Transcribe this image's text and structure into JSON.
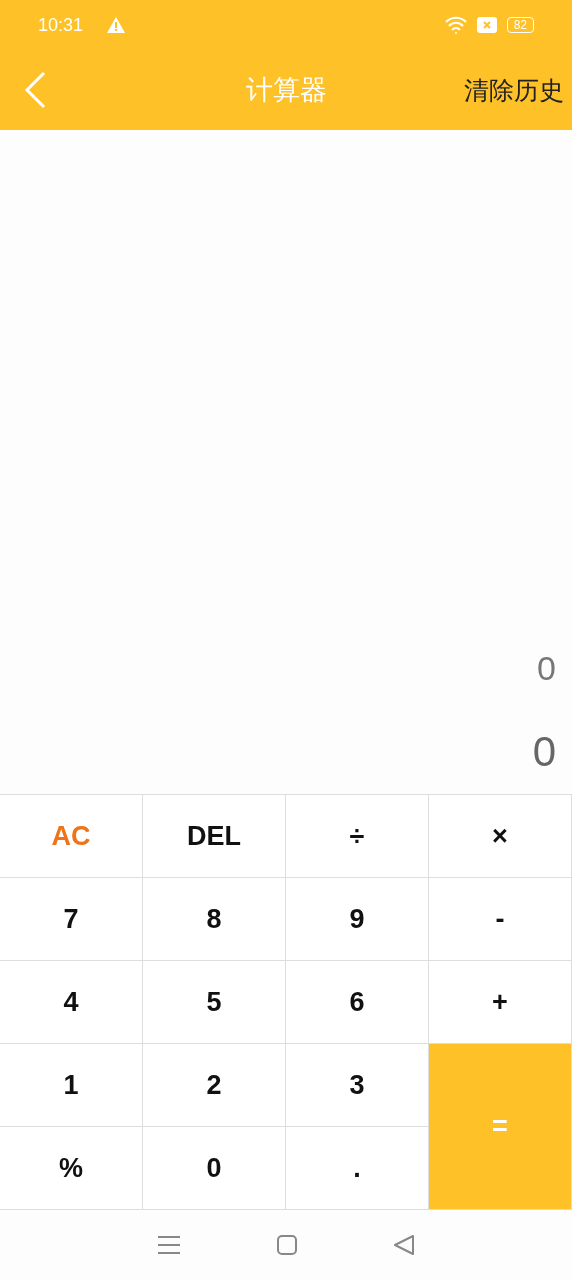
{
  "status_bar": {
    "time": "10:31",
    "battery": "82"
  },
  "header": {
    "title": "计算器",
    "action": "清除历史"
  },
  "display": {
    "expression": "0",
    "result": "0"
  },
  "keys": [
    {
      "label": "AC",
      "kind": "clear"
    },
    {
      "label": "DEL",
      "kind": "normal"
    },
    {
      "label": "÷",
      "kind": "normal"
    },
    {
      "label": "×",
      "kind": "normal"
    },
    {
      "label": "7",
      "kind": "normal"
    },
    {
      "label": "8",
      "kind": "normal"
    },
    {
      "label": "9",
      "kind": "normal"
    },
    {
      "label": "-",
      "kind": "normal"
    },
    {
      "label": "4",
      "kind": "normal"
    },
    {
      "label": "5",
      "kind": "normal"
    },
    {
      "label": "6",
      "kind": "normal"
    },
    {
      "label": "+",
      "kind": "normal"
    },
    {
      "label": "1",
      "kind": "normal"
    },
    {
      "label": "2",
      "kind": "normal"
    },
    {
      "label": "3",
      "kind": "normal"
    },
    {
      "label": "=",
      "kind": "equals"
    },
    {
      "label": "%",
      "kind": "normal"
    },
    {
      "label": "0",
      "kind": "normal"
    },
    {
      "label": ".",
      "kind": "normal"
    }
  ]
}
